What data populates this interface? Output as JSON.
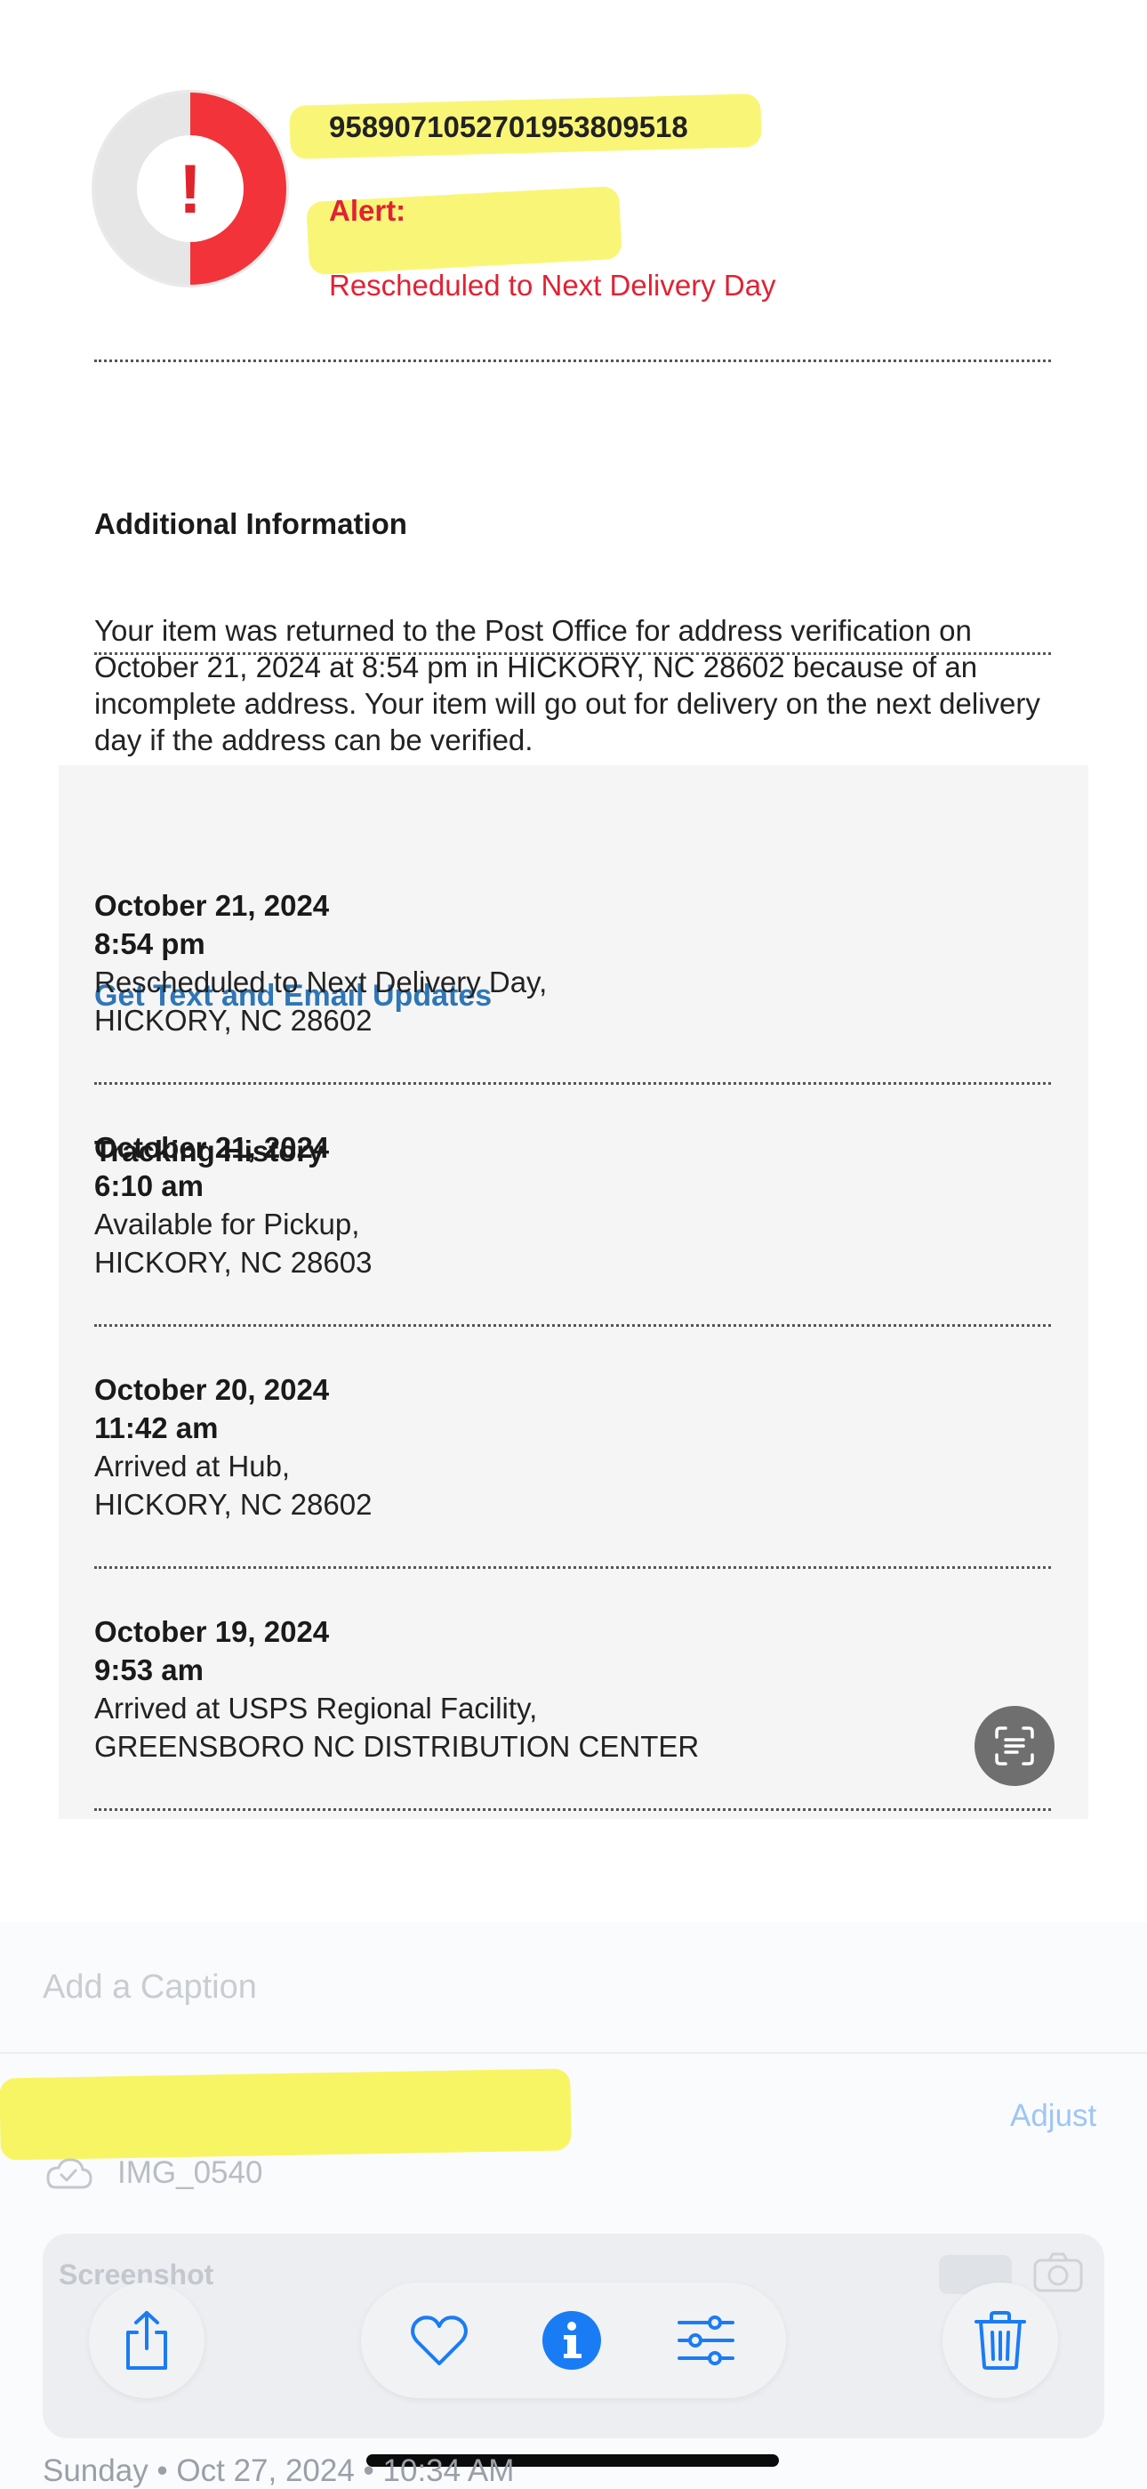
{
  "package": {
    "tracking_number": "9589071052701953809518",
    "alert_label": "Alert:",
    "alert_status": "Rescheduled to Next Delivery Day",
    "status_icon_symbol": "!",
    "status_color": "#f2333a"
  },
  "additional_info": {
    "heading": "Additional Information",
    "body": "Your item was returned to the Post Office for address verification on October 21, 2024 at 8:54 pm in HICKORY, NC 28602 because of an incomplete address. Your item will go out for delivery on the next delivery day if the address can be verified."
  },
  "updates_link": "Get Text and Email Updates",
  "tracking_history": {
    "heading": "Tracking History",
    "events": [
      {
        "date": "October 21, 2024",
        "time": "8:54 pm",
        "status": "Rescheduled to Next Delivery Day,",
        "location": "HICKORY, NC 28602"
      },
      {
        "date": "October 21, 2024",
        "time": "6:10 am",
        "status": "Available for Pickup,",
        "location": "HICKORY, NC 28603"
      },
      {
        "date": "October 20, 2024",
        "time": "11:42 am",
        "status": "Arrived at Hub,",
        "location": "HICKORY, NC 28602"
      },
      {
        "date": "October 19, 2024",
        "time": "9:53 am",
        "status": "Arrived at USPS Regional Facility,",
        "location": "GREENSBORO NC DISTRIBUTION CENTER"
      }
    ]
  },
  "photo_info": {
    "caption_placeholder": "Add a Caption",
    "date_line": "Sunday • Oct 27, 2024 • 10:34 AM",
    "adjust_label": "Adjust",
    "filename": "IMG_0540",
    "card_title": "Screenshot"
  },
  "toolbar": {
    "icons": [
      "share-icon",
      "heart-icon",
      "info-icon",
      "sliders-icon",
      "trash-icon"
    ],
    "accent_color": "#1a7cf5"
  },
  "highlight_color": "#f7f34a"
}
